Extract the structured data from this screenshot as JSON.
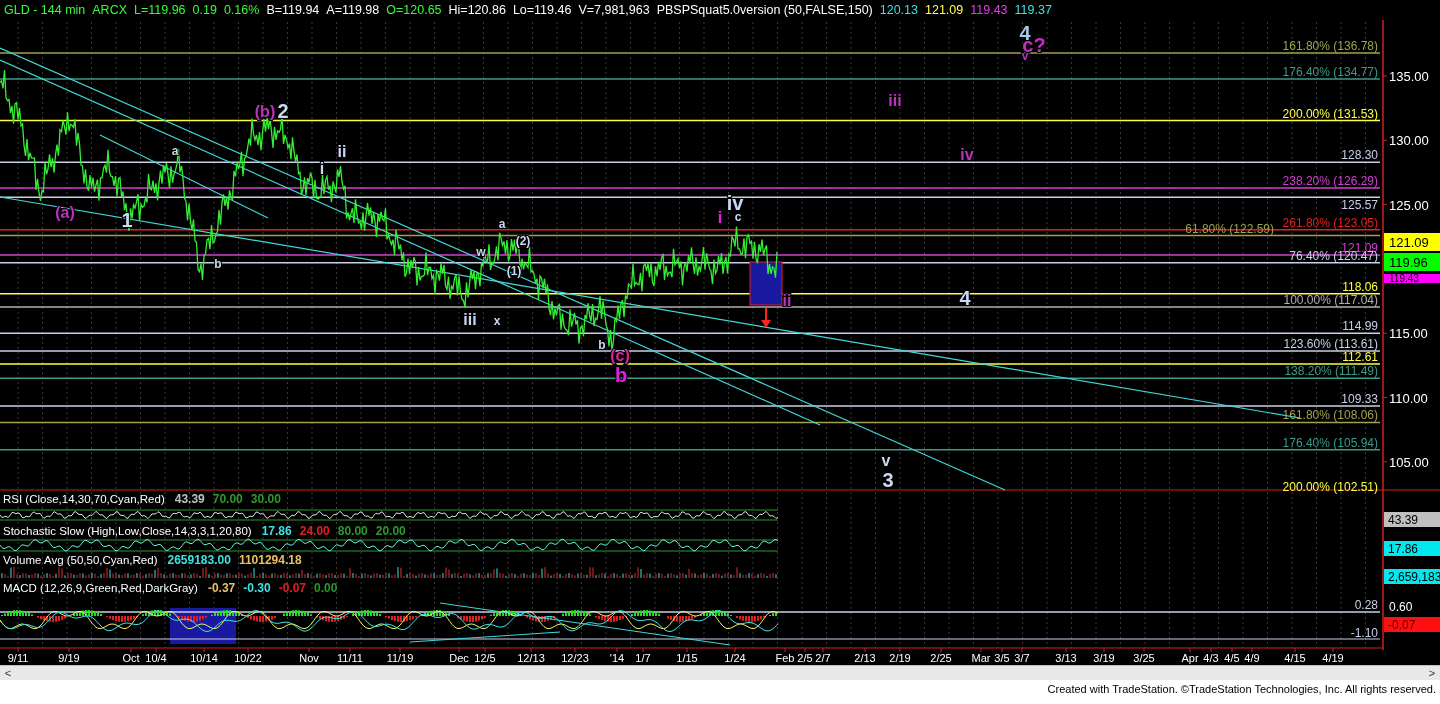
{
  "header": [
    {
      "text": "GLD - 144 min",
      "color": "#33ff33"
    },
    {
      "text": "ARCX",
      "color": "#33ff33"
    },
    {
      "text": "L=119.96",
      "color": "#33ff33"
    },
    {
      "text": "0.19",
      "color": "#33ff33"
    },
    {
      "text": "0.16%",
      "color": "#33ff33"
    },
    {
      "text": "B=119.94",
      "color": "#ffffff"
    },
    {
      "text": "A=119.98",
      "color": "#ffffff"
    },
    {
      "text": "O=120.65",
      "color": "#33ff33"
    },
    {
      "text": "Hi=120.86",
      "color": "#ffffff"
    },
    {
      "text": "Lo=119.46",
      "color": "#ffffff"
    },
    {
      "text": "V=7,981,963",
      "color": "#ffffff"
    },
    {
      "text": "PBSPSquat5.0version (50,FALSE,150)",
      "color": "#ffffff"
    },
    {
      "text": "120.13",
      "color": "#40e0e0"
    },
    {
      "text": "121.09",
      "color": "#ffff40"
    },
    {
      "text": "119.43",
      "color": "#e040e0"
    },
    {
      "text": "119.37",
      "color": "#40e0e0"
    }
  ],
  "levels": [
    {
      "label": "161.80% (136.78)",
      "color": "#a0a050"
    },
    {
      "label": "176.40% (134.77)",
      "color": "#3a9a8a"
    },
    {
      "label": "200.00% (131.53)",
      "color": "#ffff40"
    },
    {
      "label": "128.30",
      "color": "#c8d0e8"
    },
    {
      "label": "238.20% (126.29)",
      "color": "#d040d0"
    },
    {
      "label": "125.57",
      "color": "#c8d0e8"
    },
    {
      "label": "261.80% (123.05)",
      "color": "#e02020"
    },
    {
      "label": "61.80% (122.59)",
      "color": "#a0a050"
    },
    {
      "label": "121.09",
      "color": "#d040d0"
    },
    {
      "label": "76.40% (120.47)",
      "color": "#c8d0e8"
    },
    {
      "label": "118.06",
      "color": "#ffff40"
    },
    {
      "label": "100.00% (117.04)",
      "color": "#b0b0b0"
    },
    {
      "label": "114.99",
      "color": "#c8d0e8"
    },
    {
      "label": "123.60% (113.61)",
      "color": "#c8d0e8"
    },
    {
      "label": "112.61",
      "color": "#ffff40"
    },
    {
      "label": "138.20% (111.49)",
      "color": "#3a9a8a"
    },
    {
      "label": "109.33",
      "color": "#c8d0e8"
    },
    {
      "label": "161.80% (108.06)",
      "color": "#a0a050"
    },
    {
      "label": "176.40% (105.94)",
      "color": "#3a9a8a"
    },
    {
      "label": "200.00% (102.51)",
      "color": "#ffff40"
    }
  ],
  "price_axis": [
    "135.00",
    "130.00",
    "125.00",
    "115.00",
    "110.00",
    "105.00"
  ],
  "price_markers": [
    {
      "text": "121.09",
      "color": "#ffff00"
    },
    {
      "text": "119.96",
      "color": "#00ff00"
    },
    {
      "text": "119.43",
      "color": "#ff00ff"
    }
  ],
  "wave_labels": [
    {
      "text": "4",
      "color": "#a8c8e8",
      "kind": "big"
    },
    {
      "text": "c?",
      "color": "#c030c0",
      "kind": "big"
    },
    {
      "text": "v",
      "color": "#c030c0",
      "kind": "small"
    },
    {
      "text": "(b)",
      "color": "#c030c0",
      "kind": "mid"
    },
    {
      "text": "2",
      "color": "#c8d8f0",
      "kind": "big"
    },
    {
      "text": "iii",
      "color": "#c030c0",
      "kind": "mid"
    },
    {
      "text": "ii",
      "color": "#c8d8f0",
      "kind": "mid"
    },
    {
      "text": "iv",
      "color": "#c030c0",
      "kind": "mid"
    },
    {
      "text": "i",
      "color": "#c8d8f0",
      "kind": "mid"
    },
    {
      "text": "1",
      "color": "#c8d8f0",
      "kind": "big"
    },
    {
      "text": "(a)",
      "color": "#c030c0",
      "kind": "mid"
    },
    {
      "text": "a",
      "color": "#c8d8f0",
      "kind": "small"
    },
    {
      "text": "b",
      "color": "#c8d8f0",
      "kind": "small"
    },
    {
      "text": "a",
      "color": "#c8d8f0",
      "kind": "small"
    },
    {
      "text": "w",
      "color": "#c8d8f0",
      "kind": "small"
    },
    {
      "text": "(2)",
      "color": "#c8d8f0",
      "kind": "small"
    },
    {
      "text": "(1)",
      "color": "#c8d8f0",
      "kind": "small"
    },
    {
      "text": "iii",
      "color": "#c8d8f0",
      "kind": "mid"
    },
    {
      "text": "x",
      "color": "#c8d8f0",
      "kind": "small"
    },
    {
      "text": "b",
      "color": "#c8d8f0",
      "kind": "small"
    },
    {
      "text": "(c)",
      "color": "#e020a0",
      "kind": "mid"
    },
    {
      "text": "b",
      "color": "#e020e0",
      "kind": "big"
    },
    {
      "text": "i",
      "color": "#e020e0",
      "kind": "mid"
    },
    {
      "text": "iv",
      "color": "#c8d8f0",
      "kind": "big"
    },
    {
      "text": "c",
      "color": "#c8d8f0",
      "kind": "small"
    },
    {
      "text": "ii",
      "color": "#c030c0",
      "kind": "mid"
    },
    {
      "text": "4",
      "color": "#c8d8f0",
      "kind": "big"
    },
    {
      "text": "v",
      "color": "#c8d8f0",
      "kind": "mid"
    },
    {
      "text": "3",
      "color": "#c8d8f0",
      "kind": "big"
    }
  ],
  "indicators": [
    {
      "title": "RSI (Close,14,30,70,Cyan,Red)",
      "values": [
        {
          "text": "43.39",
          "color": "#c0c0c0"
        },
        {
          "text": "70.00",
          "color": "#2a9a2a"
        },
        {
          "text": "30.00",
          "color": "#2a9a2a"
        }
      ],
      "reading": {
        "text": "43.39",
        "color": "#c0c0c0"
      }
    },
    {
      "title": "Stochastic Slow (High,Low,Close,14,3,3,1,20,80)",
      "values": [
        {
          "text": "17.86",
          "color": "#40e0e0"
        },
        {
          "text": "24.00",
          "color": "#e02020"
        },
        {
          "text": "80.00",
          "color": "#2a9a2a"
        },
        {
          "text": "20.00",
          "color": "#2a9a2a"
        }
      ],
      "reading": {
        "text": "17.86",
        "color": "#00e8f0"
      }
    },
    {
      "title": "Volume Avg (50,50,Cyan,Red)",
      "values": [
        {
          "text": "2659183.00",
          "color": "#40e0e0"
        },
        {
          "text": "1101294.18",
          "color": "#e8c060"
        }
      ],
      "reading": {
        "text": "2,659,183",
        "color": "#00e8f0"
      }
    },
    {
      "title": "MACD (12,26,9,Green,Red,DarkGray)",
      "values": [
        {
          "text": "-0.37",
          "color": "#e8c060"
        },
        {
          "text": "-0.30",
          "color": "#40e0e0"
        },
        {
          "text": "-0.07",
          "color": "#e02020"
        },
        {
          "text": "0.00",
          "color": "#2a9a2a"
        }
      ],
      "reading": {
        "text": "-0.07",
        "color": "#ff1010"
      }
    }
  ],
  "macd_axis": {
    "tick": "0.60",
    "upper_line": "0.28",
    "lower_line": "-1.10"
  },
  "dates": [
    "9/11",
    "9/19",
    "Oct",
    "10/4",
    "10/14",
    "10/22",
    "Nov",
    "11/11",
    "11/19",
    "Dec",
    "12/5",
    "12/13",
    "12/23",
    "'14",
    "1/7",
    "1/15",
    "1/24",
    "Feb",
    "2/5",
    "2/7",
    "2/13",
    "2/19",
    "2/25",
    "Mar",
    "3/5",
    "3/7",
    "3/13",
    "3/19",
    "3/25",
    "Apr",
    "4/3",
    "4/5",
    "4/9",
    "4/15",
    "4/19"
  ],
  "scrollbar": {
    "left": "<",
    "right": ">"
  },
  "footer": "Created with TradeStation. ©TradeStation Technologies, Inc. All rights reserved."
}
